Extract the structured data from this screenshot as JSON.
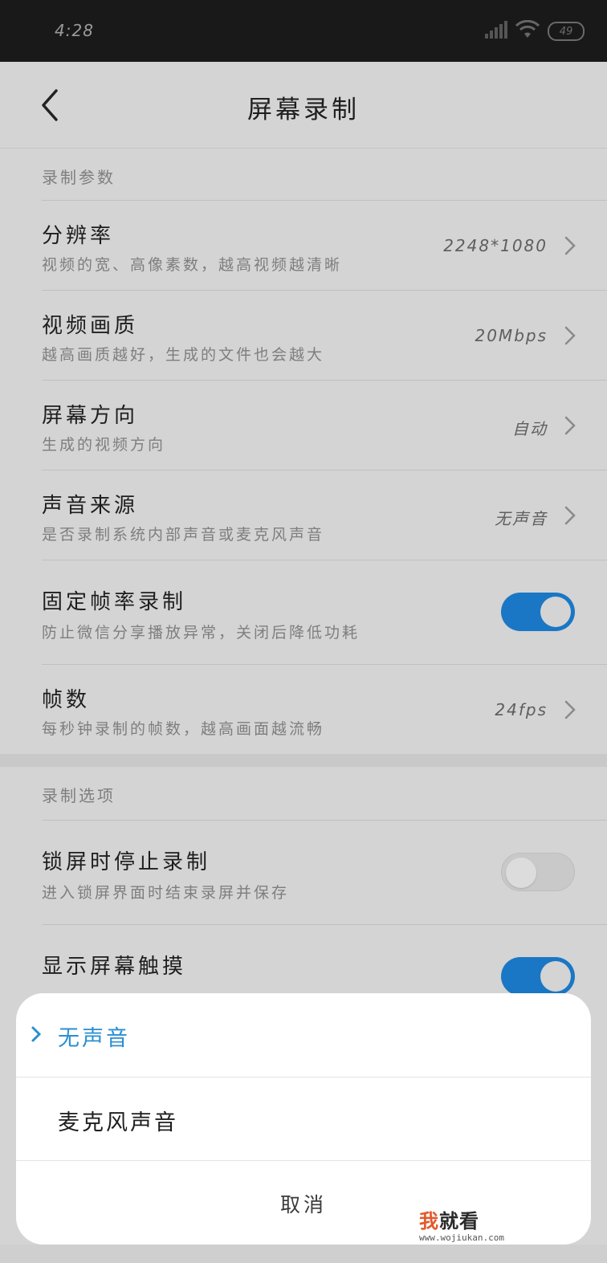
{
  "status_bar": {
    "time": "4:28",
    "battery": "49",
    "icons": [
      "signal-icon",
      "wifi-icon",
      "battery-icon"
    ]
  },
  "header": {
    "title": "屏幕录制",
    "back_icon": "chevron-left-icon"
  },
  "sections": [
    {
      "label": "录制参数",
      "rows": [
        {
          "title": "分辨率",
          "subtitle": "视频的宽、高像素数，越高视频越清晰",
          "value": "2248*1080",
          "control": "chevron"
        },
        {
          "title": "视频画质",
          "subtitle": "越高画质越好，生成的文件也会越大",
          "value": "20Mbps",
          "control": "chevron"
        },
        {
          "title": "屏幕方向",
          "subtitle": "生成的视频方向",
          "value": "自动",
          "control": "chevron"
        },
        {
          "title": "声音来源",
          "subtitle": "是否录制系统内部声音或麦克风声音",
          "value": "无声音",
          "control": "chevron"
        },
        {
          "title": "固定帧率录制",
          "subtitle": "防止微信分享播放异常，关闭后降低功耗",
          "toggle_on": true,
          "control": "toggle"
        },
        {
          "title": "帧数",
          "subtitle": "每秒钟录制的帧数，越高画面越流畅",
          "value": "24fps",
          "control": "chevron"
        }
      ]
    },
    {
      "label": "录制选项",
      "rows": [
        {
          "title": "锁屏时停止录制",
          "subtitle": "进入锁屏界面时结束录屏并保存",
          "toggle_on": false,
          "control": "toggle"
        },
        {
          "title": "显示屏幕触摸",
          "subtitle": "",
          "toggle_on": true,
          "control": "toggle"
        }
      ]
    }
  ],
  "sheet": {
    "options": [
      {
        "label": "无声音",
        "selected": true
      },
      {
        "label": "麦克风声音",
        "selected": false
      }
    ],
    "cancel_label": "取消"
  },
  "watermark": {
    "logo_accent": "我",
    "logo_rest": "就看",
    "url": "www.wojiukan.com"
  },
  "colors": {
    "accent": "#1a77c5",
    "selected_text": "#2a8fd1",
    "background_dimmed": "#d4d4d4",
    "sheet_background": "#ffffff"
  }
}
